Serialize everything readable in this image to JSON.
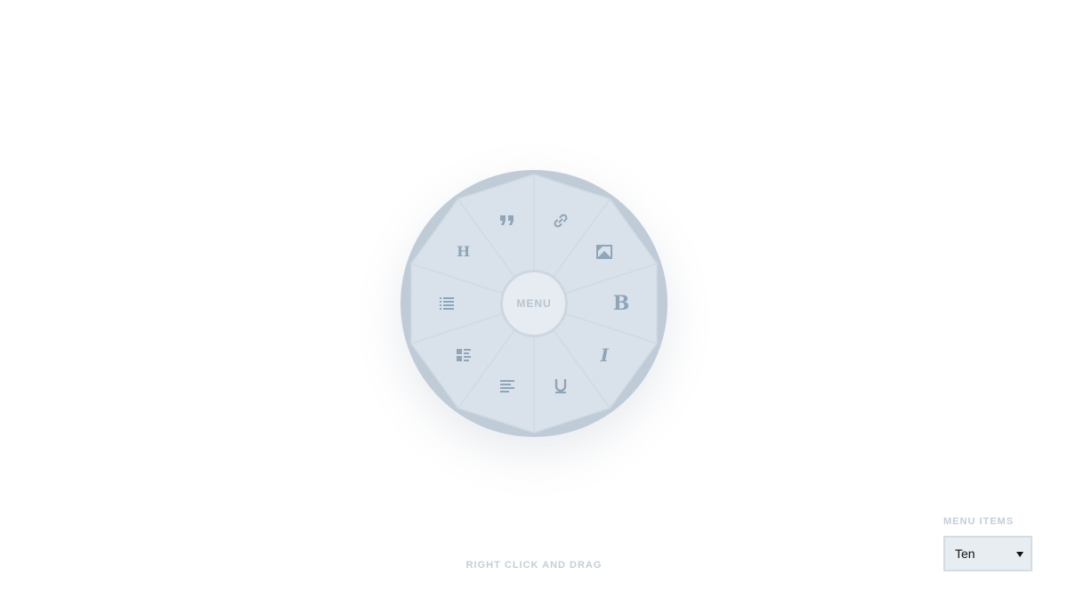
{
  "menu": {
    "center_label": "MENU",
    "items": [
      {
        "name": "link",
        "icon": "link-icon"
      },
      {
        "name": "image",
        "icon": "image-icon"
      },
      {
        "name": "bold",
        "icon": "bold-icon",
        "glyph": "B"
      },
      {
        "name": "italic",
        "icon": "italic-icon",
        "glyph": "I"
      },
      {
        "name": "underline",
        "icon": "underline-icon"
      },
      {
        "name": "align-left",
        "icon": "align-left-icon"
      },
      {
        "name": "block-list",
        "icon": "block-list-icon"
      },
      {
        "name": "list",
        "icon": "list-icon"
      },
      {
        "name": "heading",
        "icon": "heading-icon",
        "glyph": "H"
      },
      {
        "name": "quote",
        "icon": "quote-icon"
      }
    ]
  },
  "hint": "RIGHT CLICK AND DRAG",
  "menu_items_control": {
    "label": "MENU ITEMS",
    "selected": "Ten"
  },
  "colors": {
    "outer_ring": "#bfccd8",
    "segment_fill": "#d9e2ea",
    "icon": "#8fa5b8",
    "center_fill": "#e6ecf1",
    "muted_text": "#c3ced8"
  }
}
